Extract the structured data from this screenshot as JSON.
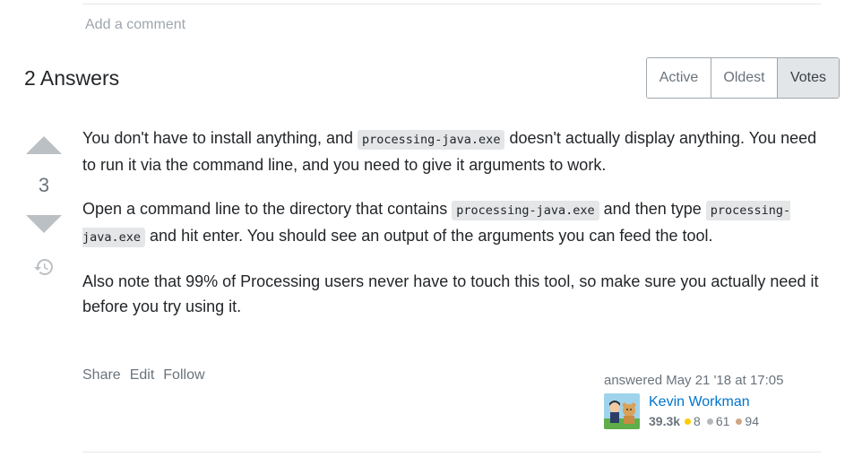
{
  "comments": {
    "add_comment": "Add a comment"
  },
  "answers": {
    "title": "2 Answers",
    "sort": {
      "tabs": [
        "Active",
        "Oldest",
        "Votes"
      ],
      "active": "Votes"
    }
  },
  "answer": {
    "vote_count": "3",
    "body": {
      "p1_a": "You don't have to install anything, and ",
      "p1_code": "processing-java.exe",
      "p1_b": " doesn't actually display anything. You need to run it via the command line, and you need to give it arguments to work.",
      "p2_a": "Open a command line to the directory that contains ",
      "p2_code1": "processing-java.exe",
      "p2_b": " and then type ",
      "p2_code2": "processing-java.exe",
      "p2_c": " and hit enter. You should see an output of the arguments you can feed the tool.",
      "p3": "Also note that 99% of Processing users never have to touch this tool, so make sure you actually need it before you try using it."
    },
    "menu": {
      "share": "Share",
      "edit": "Edit",
      "follow": "Follow"
    },
    "author": {
      "answered": "answered May 21 '18 at 17:05",
      "name": "Kevin Workman",
      "reputation": "39.3k",
      "gold": "8",
      "silver": "61",
      "bronze": "94"
    }
  },
  "colors": {
    "link": "#0074cc",
    "gold": "#ffcc01",
    "silver": "#b4b8bc",
    "bronze": "#d1a684",
    "vote_arrow": "#bbc0c4"
  },
  "icons": {
    "upvote": "triangle-up",
    "downvote": "triangle-down",
    "history": "clock-history"
  }
}
